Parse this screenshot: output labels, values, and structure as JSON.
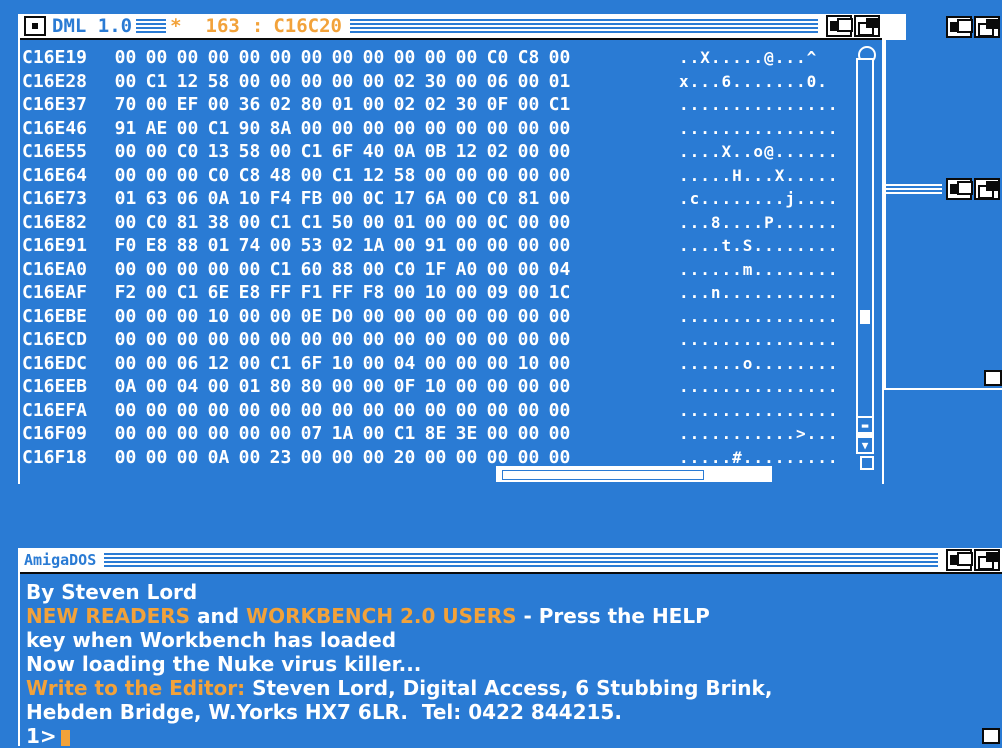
{
  "dml_window": {
    "title": "DML 1.0",
    "star": "*",
    "count": "163",
    "colon": ":",
    "address": "C16C20"
  },
  "hex_rows": [
    {
      "addr": "C16E19",
      "bytes": [
        "00",
        "00",
        "00",
        "00",
        "00",
        "00",
        "00",
        "00",
        "00",
        "00",
        "00",
        "00",
        "C0",
        "C8",
        "00"
      ],
      "ascii": "..X.....@...^"
    },
    {
      "addr": "C16E28",
      "bytes": [
        "00",
        "C1",
        "12",
        "58",
        "00",
        "00",
        "00",
        "00",
        "00",
        "02",
        "30",
        "00",
        "06",
        "00",
        "01"
      ],
      "ascii": "x...6.......0."
    },
    {
      "addr": "C16E37",
      "bytes": [
        "70",
        "00",
        "EF",
        "00",
        "36",
        "02",
        "80",
        "01",
        "00",
        "02",
        "02",
        "30",
        "0F",
        "00",
        "C1"
      ],
      "ascii": "..............."
    },
    {
      "addr": "C16E46",
      "bytes": [
        "91",
        "AE",
        "00",
        "C1",
        "90",
        "8A",
        "00",
        "00",
        "00",
        "00",
        "00",
        "00",
        "00",
        "00",
        "00"
      ],
      "ascii": "..............."
    },
    {
      "addr": "C16E55",
      "bytes": [
        "00",
        "00",
        "C0",
        "13",
        "58",
        "00",
        "C1",
        "6F",
        "40",
        "0A",
        "0B",
        "12",
        "02",
        "00",
        "00"
      ],
      "ascii": "....X..o@......"
    },
    {
      "addr": "C16E64",
      "bytes": [
        "00",
        "00",
        "00",
        "C0",
        "C8",
        "48",
        "00",
        "C1",
        "12",
        "58",
        "00",
        "00",
        "00",
        "00",
        "00"
      ],
      "ascii": ".....H...X....."
    },
    {
      "addr": "C16E73",
      "bytes": [
        "01",
        "63",
        "06",
        "0A",
        "10",
        "F4",
        "FB",
        "00",
        "0C",
        "17",
        "6A",
        "00",
        "C0",
        "81",
        "00"
      ],
      "ascii": ".c........j...."
    },
    {
      "addr": "C16E82",
      "bytes": [
        "00",
        "C0",
        "81",
        "38",
        "00",
        "C1",
        "C1",
        "50",
        "00",
        "01",
        "00",
        "00",
        "0C",
        "00",
        "00"
      ],
      "ascii": "...8....P......"
    },
    {
      "addr": "C16E91",
      "bytes": [
        "F0",
        "E8",
        "88",
        "01",
        "74",
        "00",
        "53",
        "02",
        "1A",
        "00",
        "91",
        "00",
        "00",
        "00",
        "00"
      ],
      "ascii": "....t.S........"
    },
    {
      "addr": "C16EA0",
      "bytes": [
        "00",
        "00",
        "00",
        "00",
        "00",
        "C1",
        "60",
        "88",
        "00",
        "C0",
        "1F",
        "A0",
        "00",
        "00",
        "04"
      ],
      "ascii": "......m........"
    },
    {
      "addr": "C16EAF",
      "bytes": [
        "F2",
        "00",
        "C1",
        "6E",
        "E8",
        "FF",
        "F1",
        "FF",
        "F8",
        "00",
        "10",
        "00",
        "09",
        "00",
        "1C"
      ],
      "ascii": "...n..........."
    },
    {
      "addr": "C16EBE",
      "bytes": [
        "00",
        "00",
        "00",
        "10",
        "00",
        "00",
        "0E",
        "D0",
        "00",
        "00",
        "00",
        "00",
        "00",
        "00",
        "00"
      ],
      "ascii": "..............."
    },
    {
      "addr": "C16ECD",
      "bytes": [
        "00",
        "00",
        "00",
        "00",
        "00",
        "00",
        "00",
        "00",
        "00",
        "00",
        "00",
        "00",
        "00",
        "00",
        "00"
      ],
      "ascii": "..............."
    },
    {
      "addr": "C16EDC",
      "bytes": [
        "00",
        "00",
        "06",
        "12",
        "00",
        "C1",
        "6F",
        "10",
        "00",
        "04",
        "00",
        "00",
        "00",
        "10",
        "00"
      ],
      "ascii": "......o........"
    },
    {
      "addr": "C16EEB",
      "bytes": [
        "0A",
        "00",
        "04",
        "00",
        "01",
        "80",
        "80",
        "00",
        "00",
        "0F",
        "10",
        "00",
        "00",
        "00",
        "00"
      ],
      "ascii": "..............."
    },
    {
      "addr": "C16EFA",
      "bytes": [
        "00",
        "00",
        "00",
        "00",
        "00",
        "00",
        "00",
        "00",
        "00",
        "00",
        "00",
        "00",
        "00",
        "00",
        "00"
      ],
      "ascii": "..............."
    },
    {
      "addr": "C16F09",
      "bytes": [
        "00",
        "00",
        "00",
        "00",
        "00",
        "00",
        "07",
        "1A",
        "00",
        "C1",
        "8E",
        "3E",
        "00",
        "00",
        "00"
      ],
      "ascii": "...........>..."
    },
    {
      "addr": "C16F18",
      "bytes": [
        "00",
        "00",
        "00",
        "0A",
        "00",
        "23",
        "00",
        "00",
        "00",
        "20",
        "00",
        "00",
        "00",
        "00",
        "00"
      ],
      "ascii": ".....#........."
    }
  ],
  "shell": {
    "title": "AmigaDOS",
    "lines": [
      {
        "segments": [
          {
            "text": "By Steven Lord",
            "hl": false
          }
        ]
      },
      {
        "segments": [
          {
            "text": "NEW READERS",
            "hl": true
          },
          {
            "text": " and ",
            "hl": false
          },
          {
            "text": "WORKBENCH 2.0 USERS",
            "hl": true
          },
          {
            "text": " - Press the HELP",
            "hl": false
          }
        ]
      },
      {
        "segments": [
          {
            "text": "key when Workbench has loaded",
            "hl": false
          }
        ]
      },
      {
        "segments": [
          {
            "text": "Now loading the Nuke virus killer...",
            "hl": false
          }
        ]
      },
      {
        "segments": [
          {
            "text": "Write to the Editor:",
            "hl": true
          },
          {
            "text": " Steven Lord, Digital Access, 6 Stubbing Brink,",
            "hl": false
          }
        ]
      },
      {
        "segments": [
          {
            "text": "Hebden Bridge, W.Yorks HX7 6LR.  Tel: 0422 844215.",
            "hl": false
          }
        ]
      }
    ],
    "prompt": "1>"
  },
  "colors": {
    "background": "#2a7bd4",
    "titlebar": "#ffffff",
    "highlight": "#f2a23a",
    "text": "#ffffff"
  }
}
